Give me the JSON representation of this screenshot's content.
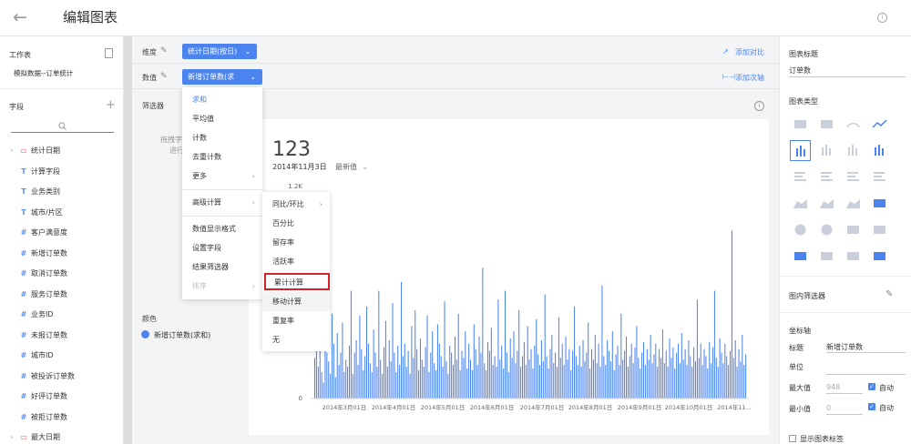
{
  "header": {
    "back_icon": "arrow-left-icon",
    "title": "编辑图表",
    "info_icon": "info-icon"
  },
  "left_panel": {
    "worksheet_label": "工作表",
    "worksheet_name": "模拟数据--订单统计",
    "fields_label": "字段",
    "add_icon": "plus-icon",
    "search_icon": "search-icon",
    "fields": [
      {
        "icon": "calendar-icon",
        "glyph": "▭",
        "label": "统计日期",
        "expandable": true
      },
      {
        "icon": "text-icon",
        "glyph": "T",
        "label": "计算字段"
      },
      {
        "icon": "text-icon",
        "glyph": "T",
        "label": "业务类别"
      },
      {
        "icon": "text-icon",
        "glyph": "T",
        "label": "城市/片区"
      },
      {
        "icon": "number-icon",
        "glyph": "#",
        "label": "客户满意度"
      },
      {
        "icon": "number-icon",
        "glyph": "#",
        "label": "新增订单数"
      },
      {
        "icon": "number-icon",
        "glyph": "#",
        "label": "取消订单数"
      },
      {
        "icon": "number-icon",
        "glyph": "#",
        "label": "服务订单数"
      },
      {
        "icon": "number-icon",
        "glyph": "#",
        "label": "业务ID"
      },
      {
        "icon": "number-icon",
        "glyph": "#",
        "label": "未报订单数"
      },
      {
        "icon": "number-icon",
        "glyph": "#",
        "label": "城市ID"
      },
      {
        "icon": "number-icon",
        "glyph": "#",
        "label": "被投诉订单数"
      },
      {
        "icon": "number-icon",
        "glyph": "#",
        "label": "好评订单数"
      },
      {
        "icon": "number-icon",
        "glyph": "#",
        "label": "被拒订单数"
      },
      {
        "icon": "calendar-icon",
        "glyph": "▭",
        "label": "最大日期",
        "expandable": true
      }
    ]
  },
  "config": {
    "dimension_label": "维度",
    "dimension_pill": "统计日期(按日)",
    "value_label": "数值",
    "value_pill": "新增订单数(求和)",
    "filter_label": "筛选器",
    "filter_hint_1": "拖拽字",
    "filter_hint_2": "进行",
    "add_compare": "添加对比",
    "add_axis": "添加次轴",
    "color_label": "颜色",
    "color_legend": "新增订单数(求和)",
    "accent": "#4c84ef"
  },
  "chart": {
    "big_number": "123",
    "date_label": "2014年11月3日",
    "latest_label": "最新值"
  },
  "menu_primary": {
    "items": [
      "求和",
      "平均值",
      "计数",
      "去重计数",
      "更多"
    ],
    "items2": [
      "高级计算"
    ],
    "items3": [
      "数值显示格式",
      "设置字段",
      "结果筛选器",
      "排序"
    ]
  },
  "menu_secondary": {
    "items": [
      "同比/环比",
      "百分比",
      "留存率",
      "活跃率",
      "累计计算",
      "移动计算",
      "重复率",
      "无"
    ]
  },
  "right_panel": {
    "chart_title_label": "图表标题",
    "chart_title_value": "订单数",
    "chart_type_label": "图表类型",
    "inner_filter_label": "图内筛选器",
    "axis_label": "坐标轴",
    "axis_title_label": "标题",
    "axis_title_value": "新增订单数",
    "unit_label": "单位",
    "max_label": "最大值",
    "max_value": "948",
    "auto_label": "自动",
    "min_label": "最小值",
    "min_value": "0",
    "show_labels": "显示图表标签"
  },
  "chart_data": {
    "type": "bar",
    "title": "",
    "ylim": [
      0,
      1200
    ],
    "y_ticks": [
      "1.2K",
      "0"
    ],
    "x_ticks": [
      "2014年3月01日",
      "2014年4月01日",
      "2014年5月01日",
      "2014年6月01日",
      "2014年7月01日",
      "2014年8月01日",
      "2014年9月01日",
      "2014年10月01日",
      "2014年11..."
    ],
    "series": [
      {
        "values": [
          230,
          420,
          180,
          320,
          150,
          90,
          560,
          260,
          210,
          140,
          480,
          310,
          120,
          370,
          190,
          260,
          430,
          150,
          220,
          180,
          300,
          610,
          140,
          260,
          330,
          190,
          470,
          280,
          160,
          240,
          520,
          310,
          200,
          150,
          390,
          260,
          180,
          610,
          220,
          140,
          290,
          440,
          180,
          330,
          210,
          540,
          260,
          150,
          300,
          190,
          660,
          240,
          310,
          180,
          270,
          140,
          410,
          230,
          500,
          280,
          160,
          340,
          220,
          180,
          290,
          470,
          150,
          260,
          380,
          200,
          160,
          420,
          310,
          240,
          180,
          550,
          210,
          140,
          300,
          260,
          190,
          350,
          220,
          480,
          160,
          270,
          230,
          380,
          170,
          310,
          220,
          160,
          420,
          280,
          190,
          350,
          260,
          740,
          200,
          160,
          320,
          270,
          400,
          190,
          240,
          180,
          560,
          220,
          300,
          170,
          610,
          260,
          150,
          340,
          230,
          380,
          200,
          270,
          500,
          180,
          240,
          320,
          190,
          410,
          220,
          280,
          170,
          300,
          450,
          250,
          190,
          330,
          210,
          590,
          240,
          170,
          280,
          360,
          200,
          260,
          180,
          460,
          230,
          310,
          190,
          350,
          220,
          280,
          160,
          270,
          520,
          240,
          190,
          300,
          180,
          330,
          210,
          260,
          430,
          170,
          280,
          220,
          360,
          200,
          310,
          180,
          640,
          240,
          190,
          330,
          270,
          210,
          380,
          160,
          250,
          300,
          190,
          480,
          220,
          270,
          350,
          180,
          240,
          310,
          200,
          290,
          410,
          230,
          170,
          260,
          320,
          190,
          280,
          220,
          360,
          200,
          250,
          310,
          180,
          280,
          230,
          390,
          200,
          270,
          180,
          340,
          230,
          290,
          170,
          260,
          310,
          200,
          370,
          220,
          280,
          190,
          330,
          240,
          180,
          290,
          210,
          560,
          230,
          310,
          190,
          280,
          240,
          170,
          320,
          200,
          290,
          610,
          230,
          180,
          340,
          260,
          200,
          310,
          240,
          190,
          270,
          950,
          230,
          330,
          180,
          280,
          210,
          360,
          190,
          250
        ]
      }
    ]
  }
}
